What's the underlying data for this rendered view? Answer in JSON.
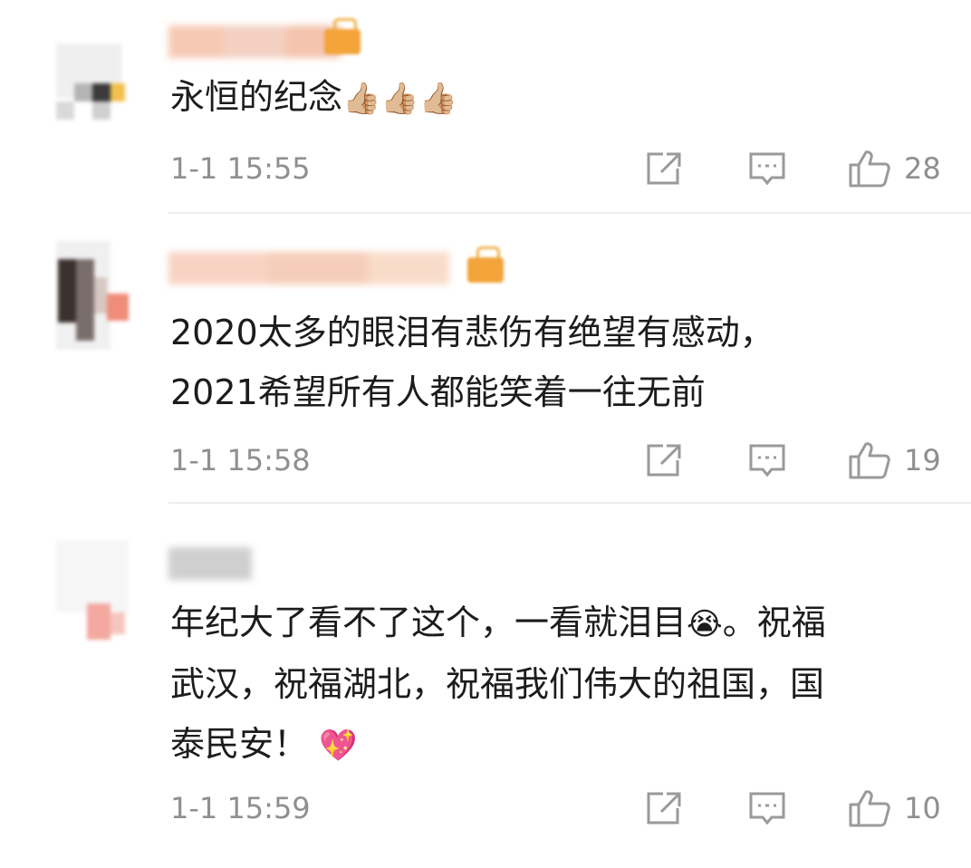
{
  "comments": [
    {
      "text": "永恒的纪念",
      "emoji": "👍🏼👍🏼👍🏼",
      "time": "1-1 15:55",
      "likes": "28",
      "icons": [
        "share-icon",
        "reply-icon",
        "thumbs-up-icon"
      ]
    },
    {
      "text": "2020太多的眼泪有悲伤有绝望有感动，\n2021希望所有人都能笑着一往无前",
      "time": "1-1 15:58",
      "likes": "19",
      "icons": [
        "share-icon",
        "reply-icon",
        "thumbs-up-icon"
      ]
    },
    {
      "text_before_emoji": "年纪大了看不了这个，一看就泪目",
      "emoji_crying": "😭",
      "text_after_emoji": "。祝福\n武汉，祝福湖北，祝福我们伟大的祖国，国\n泰民安！",
      "emoji_heart": "💖",
      "time": "1-1 15:59",
      "likes": "10",
      "icons": [
        "share-icon",
        "reply-icon",
        "thumbs-up-icon"
      ]
    }
  ],
  "colors": {
    "text": "#1c1c1c",
    "meta": "#8f8f8f",
    "icon": "#9a9a9a",
    "divider": "#ededed",
    "badge": "#f3a43a"
  }
}
